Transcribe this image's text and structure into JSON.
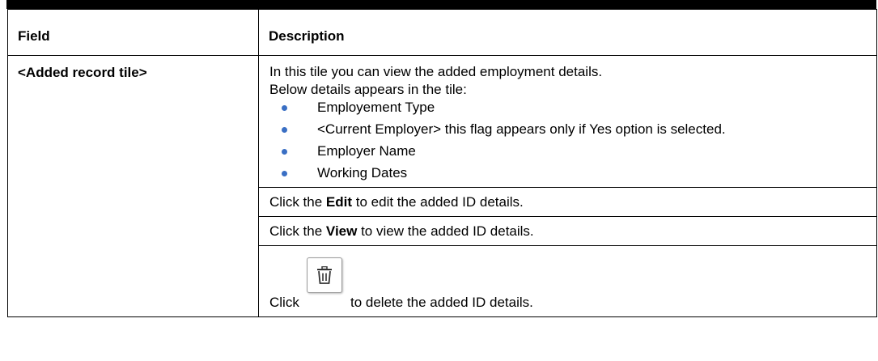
{
  "table": {
    "header": {
      "field": "Field",
      "description": "Description"
    },
    "row": {
      "field": "<Added record tile>",
      "intro_line1": "In this tile you can view the added employment details.",
      "intro_line2": "Below details appears in the tile:",
      "items": [
        "Employement Type",
        "<Current Employer> this flag appears only if Yes option is selected.",
        "Employer Name",
        "Working Dates"
      ],
      "edit_line": {
        "prefix": "Click the ",
        "bold": "Edit",
        "suffix": " to edit the added ID details."
      },
      "view_line": {
        "prefix": "Click the ",
        "bold": "View",
        "suffix": " to view the added ID details."
      },
      "delete_line": {
        "prefix": "Click",
        "icon": "trash-icon",
        "suffix": "to delete the added ID details."
      }
    }
  }
}
